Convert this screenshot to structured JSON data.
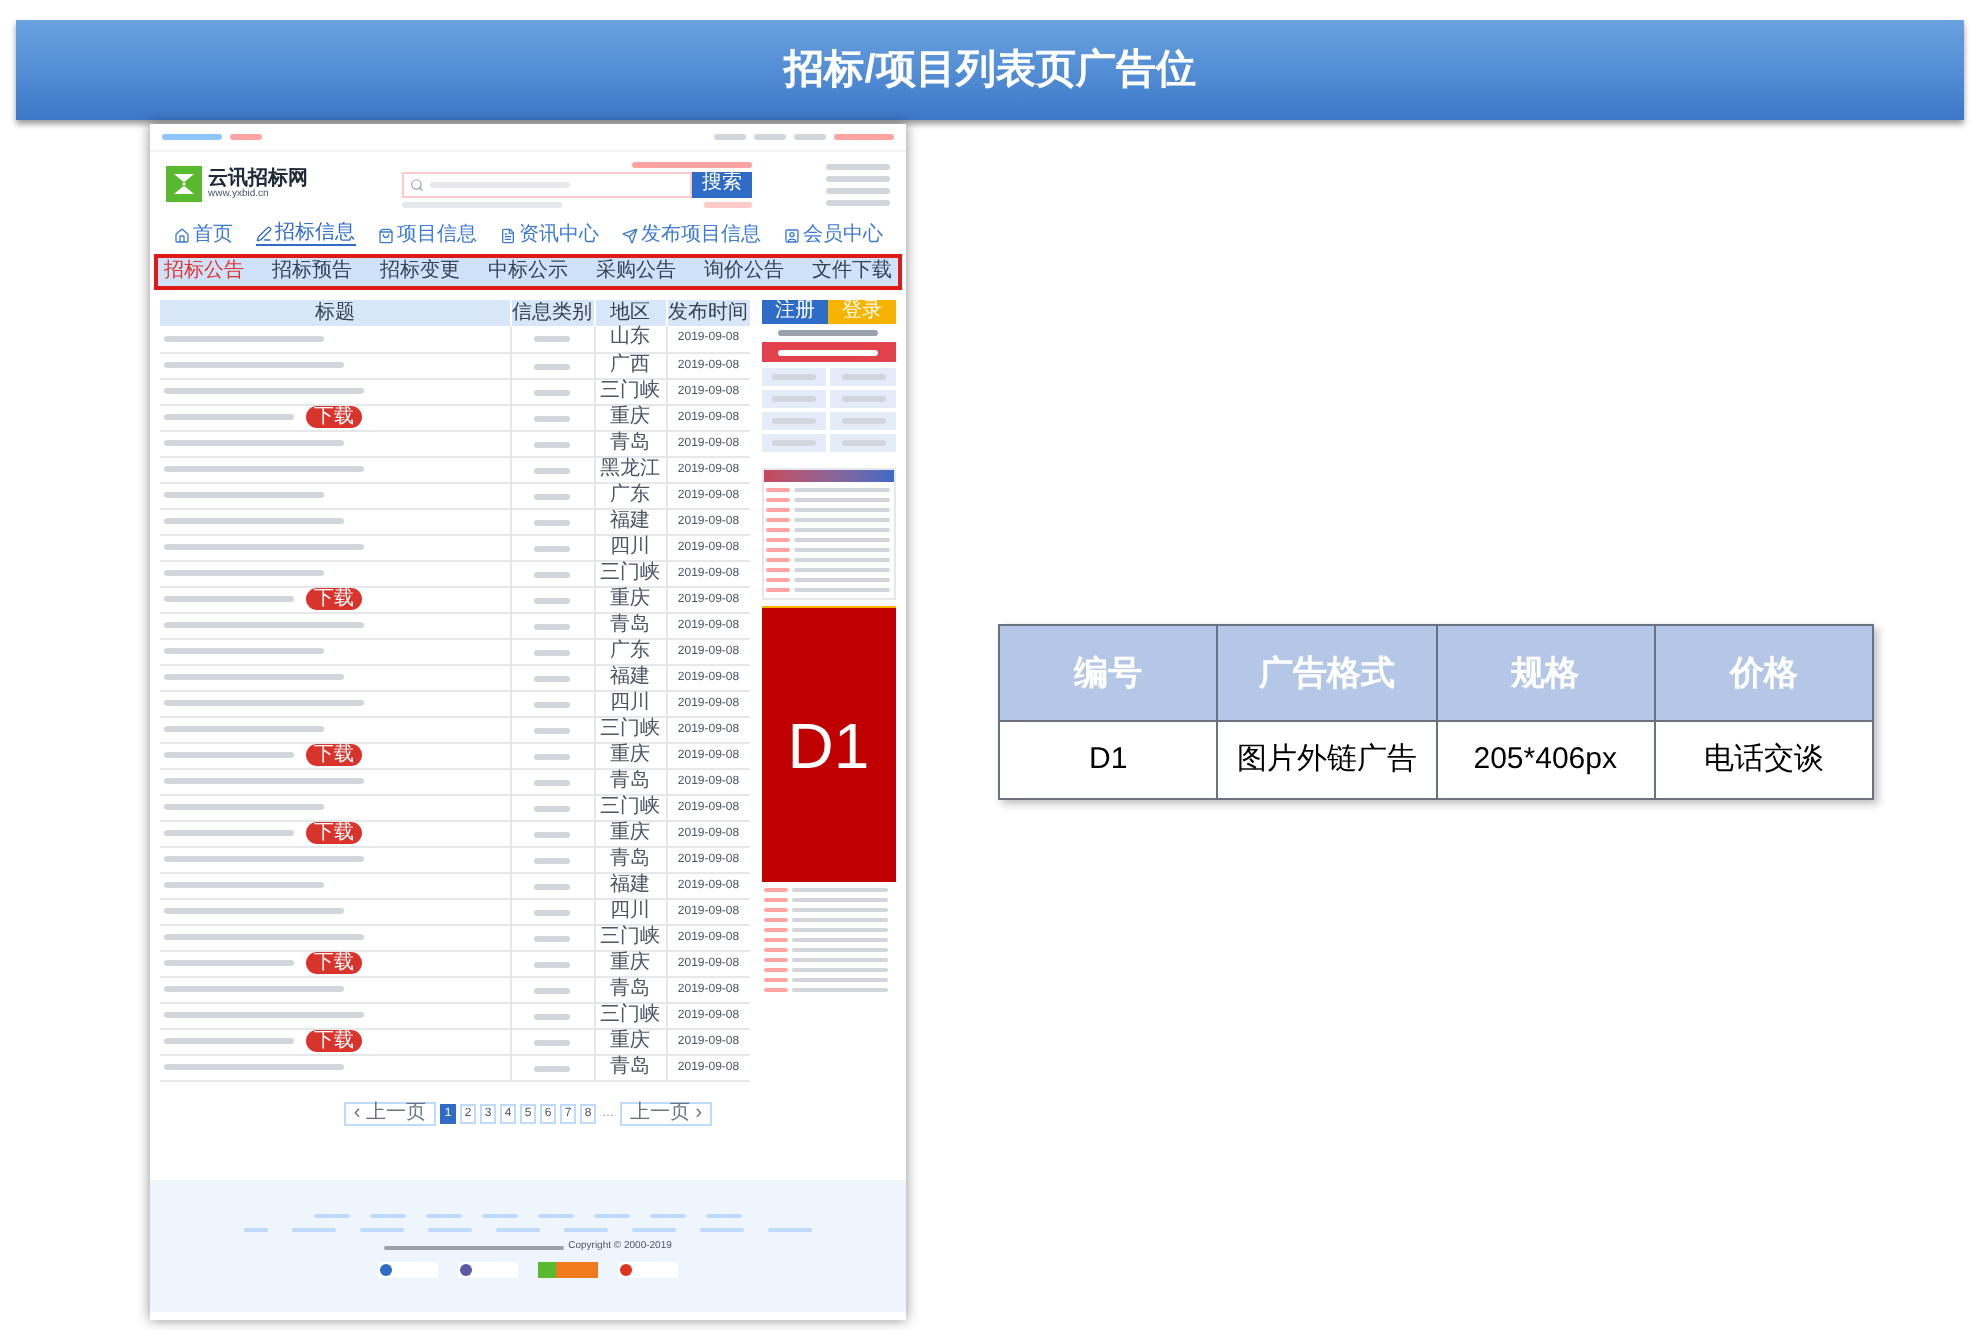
{
  "banner": {
    "title": "招标/项目列表页广告位"
  },
  "mockup": {
    "logo": {
      "name": "云讯招标网",
      "url": "www.yxbid.cn"
    },
    "search_button": "搜索",
    "nav": [
      {
        "label": "首页",
        "selected": false
      },
      {
        "label": "招标信息",
        "selected": true
      },
      {
        "label": "项目信息",
        "selected": false
      },
      {
        "label": "资讯中心",
        "selected": false
      },
      {
        "label": "发布项目信息",
        "selected": false
      },
      {
        "label": "会员中心",
        "selected": false
      }
    ],
    "subnav": [
      {
        "label": "招标公告",
        "selected": true
      },
      {
        "label": "招标预告",
        "selected": false
      },
      {
        "label": "招标变更",
        "selected": false
      },
      {
        "label": "中标公示",
        "selected": false
      },
      {
        "label": "采购公告",
        "selected": false
      },
      {
        "label": "询价公告",
        "selected": false
      },
      {
        "label": "文件下载",
        "selected": false
      }
    ],
    "table": {
      "columns": [
        "标题",
        "信息类别",
        "地区",
        "发布时间"
      ],
      "rows": [
        {
          "region": "山东",
          "date": "2019-09-08"
        },
        {
          "region": "广西",
          "date": "2019-09-08"
        },
        {
          "region": "三门峡",
          "date": "2019-09-08"
        },
        {
          "region": "重庆",
          "date": "2019-09-08",
          "badge": "下载"
        },
        {
          "region": "青岛",
          "date": "2019-09-08"
        },
        {
          "region": "黑龙江",
          "date": "2019-09-08"
        },
        {
          "region": "广东",
          "date": "2019-09-08"
        },
        {
          "region": "福建",
          "date": "2019-09-08"
        },
        {
          "region": "四川",
          "date": "2019-09-08"
        },
        {
          "region": "三门峡",
          "date": "2019-09-08"
        },
        {
          "region": "重庆",
          "date": "2019-09-08",
          "badge": "下载"
        },
        {
          "region": "青岛",
          "date": "2019-09-08"
        },
        {
          "region": "广东",
          "date": "2019-09-08"
        },
        {
          "region": "福建",
          "date": "2019-09-08"
        },
        {
          "region": "四川",
          "date": "2019-09-08"
        },
        {
          "region": "三门峡",
          "date": "2019-09-08"
        },
        {
          "region": "重庆",
          "date": "2019-09-08",
          "badge": "下载"
        },
        {
          "region": "青岛",
          "date": "2019-09-08"
        },
        {
          "region": "三门峡",
          "date": "2019-09-08"
        },
        {
          "region": "重庆",
          "date": "2019-09-08",
          "badge": "下载"
        },
        {
          "region": "青岛",
          "date": "2019-09-08"
        },
        {
          "region": "福建",
          "date": "2019-09-08"
        },
        {
          "region": "四川",
          "date": "2019-09-08"
        },
        {
          "region": "三门峡",
          "date": "2019-09-08"
        },
        {
          "region": "重庆",
          "date": "2019-09-08",
          "badge": "下载"
        },
        {
          "region": "青岛",
          "date": "2019-09-08"
        },
        {
          "region": "三门峡",
          "date": "2019-09-08"
        },
        {
          "region": "重庆",
          "date": "2019-09-08",
          "badge": "下载"
        },
        {
          "region": "青岛",
          "date": "2019-09-08"
        }
      ]
    },
    "sidebar": {
      "register": "注册",
      "login": "登录",
      "ad_slot": "D1"
    },
    "pagination": {
      "prev": "‹ 上一页",
      "pages": [
        {
          "label": "1",
          "selected": true
        },
        {
          "label": "2",
          "selected": false
        },
        {
          "label": "3",
          "selected": false
        },
        {
          "label": "4",
          "selected": false
        },
        {
          "label": "5",
          "selected": false
        },
        {
          "label": "6",
          "selected": false
        },
        {
          "label": "7",
          "selected": false
        },
        {
          "label": "8",
          "selected": false
        }
      ],
      "ellipsis": "…",
      "next": "上一页 ›"
    },
    "footer": {
      "copyright": "Copyright © 2000-2019"
    }
  },
  "spec_table": {
    "columns": [
      "编号",
      "广告格式",
      "规格",
      "价格"
    ],
    "rows": [
      [
        "D1",
        "图片外链广告",
        "205*406px",
        "电话交谈"
      ]
    ]
  }
}
